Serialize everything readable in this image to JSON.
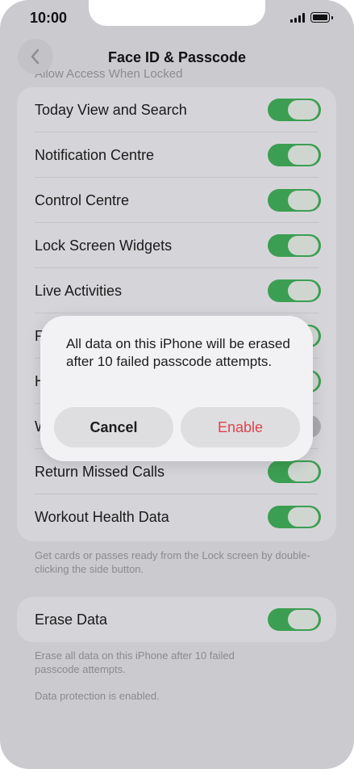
{
  "status_bar": {
    "time": "10:00"
  },
  "nav": {
    "title": "Face ID & Passcode"
  },
  "section_header": "Allow Access When Locked",
  "access_group": {
    "rows": [
      {
        "label": "Today View and Search",
        "on": true
      },
      {
        "label": "Notification Centre",
        "on": true
      },
      {
        "label": "Control Centre",
        "on": true
      },
      {
        "label": "Lock Screen Widgets",
        "on": true
      },
      {
        "label": "Live Activities",
        "on": true
      },
      {
        "label": "R",
        "on": true
      },
      {
        "label": "H",
        "on": true
      },
      {
        "label": "W",
        "on": false
      },
      {
        "label": "Return Missed Calls",
        "on": true
      },
      {
        "label": "Workout Health Data",
        "on": true
      }
    ],
    "footer": "Get cards or passes ready from the Lock screen by double-clicking the side button."
  },
  "erase_group": {
    "label": "Erase Data",
    "on": true,
    "footer": "Erase all data on this iPhone after 10 failed passcode attempts.",
    "status": "Data protection is enabled."
  },
  "alert": {
    "message": "All data on this iPhone will be erased after 10 failed passcode attempts.",
    "cancel_label": "Cancel",
    "enable_label": "Enable"
  },
  "colors": {
    "toggle_on": "#3c9e52",
    "destructive": "#e0434c"
  }
}
